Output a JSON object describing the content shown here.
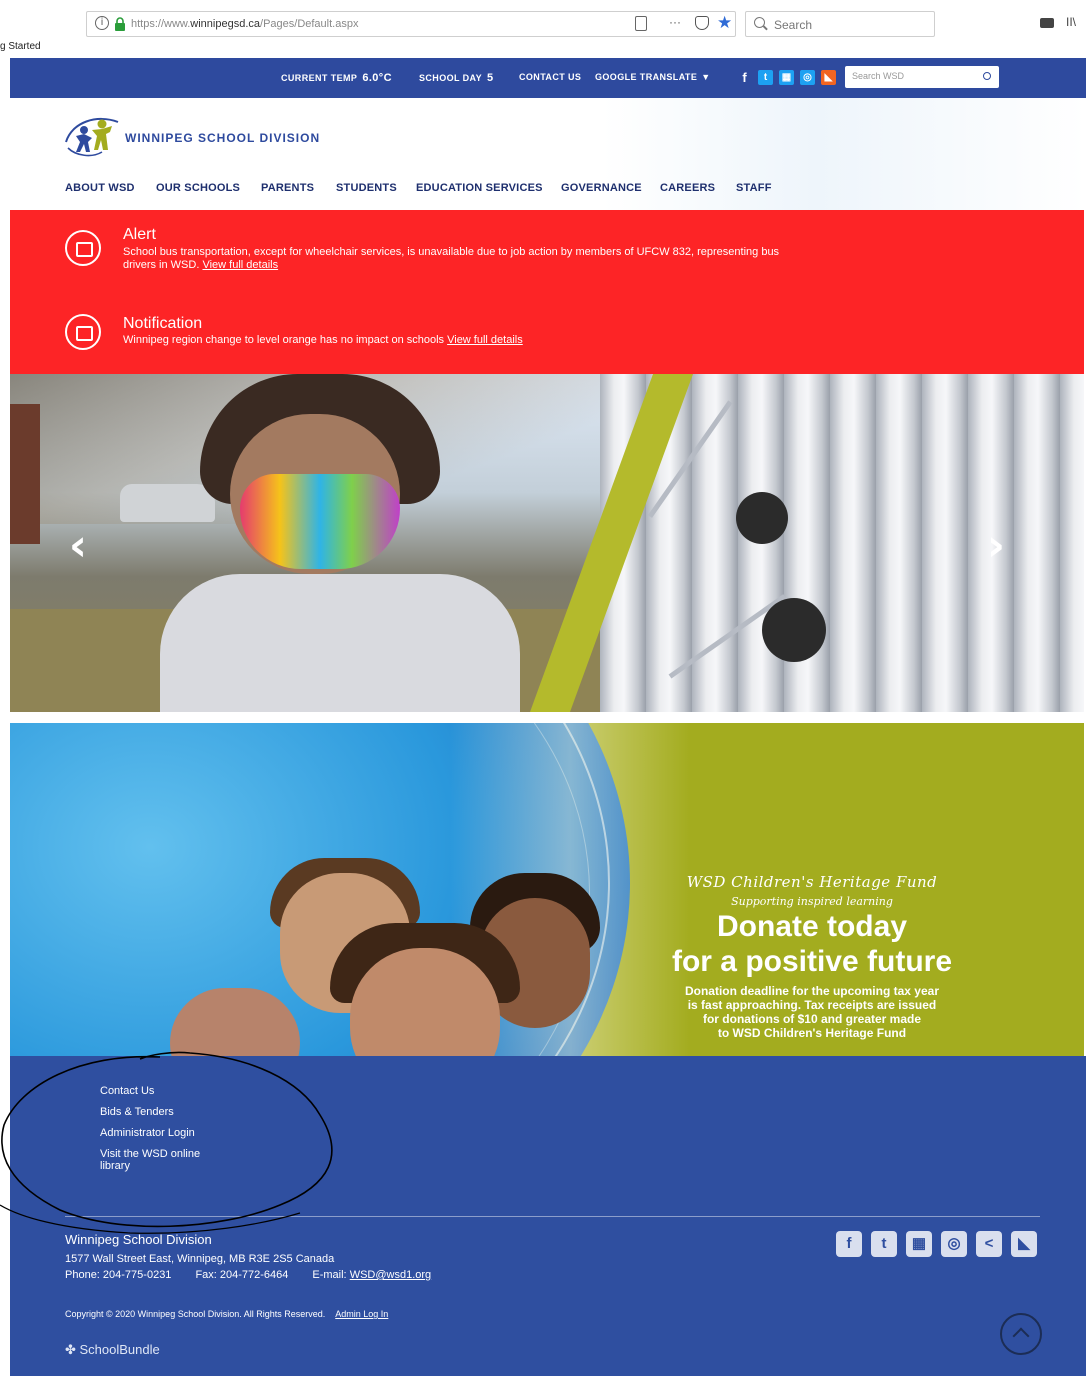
{
  "browser": {
    "url_prefix": "https://www.",
    "url_domain": "winnipegsd.ca",
    "url_path": "/Pages/Default.aspx",
    "more_label": "···",
    "search_placeholder": "Search",
    "library_label": "II\\",
    "bookmark_label": "g Started"
  },
  "topbar": {
    "temp_label": "CURRENT TEMP",
    "temp_value": "6.0°C",
    "schoolday_label": "SCHOOL DAY",
    "schoolday_value": "5",
    "contact_label": "CONTACT US",
    "translate_label": "GOOGLE TRANSLATE",
    "search_placeholder": "Search WSD",
    "social": [
      {
        "icon": "facebook-icon",
        "glyph": "f",
        "color": "#2e4a9e"
      },
      {
        "icon": "twitter-icon",
        "glyph": "t",
        "color": "#1da1f2"
      },
      {
        "icon": "calendar-icon",
        "glyph": "▦",
        "color": "#1da1f2"
      },
      {
        "icon": "instagram-icon",
        "glyph": "◎",
        "color": "#1da1f2"
      },
      {
        "icon": "rss-icon",
        "glyph": "◣",
        "color": "#f26522"
      }
    ]
  },
  "header": {
    "logo_text": "WINNIPEG SCHOOL DIVISION",
    "nav": [
      "ABOUT WSD",
      "OUR SCHOOLS",
      "PARENTS",
      "STUDENTS",
      "EDUCATION SERVICES",
      "GOVERNANCE",
      "CAREERS",
      "STAFF"
    ]
  },
  "alerts": [
    {
      "title": "Alert",
      "body_line1": "School bus transportation, except for wheelchair services, is unavailable due to job action by members of UFCW 832, representing bus",
      "body_line2": "drivers in WSD.",
      "link": "View full details"
    },
    {
      "title": "Notification",
      "body_line1": "Winnipeg region change to level orange has no impact on schools",
      "link": "View full details"
    }
  ],
  "slider": {
    "prev_glyph": "‹",
    "next_glyph": "›"
  },
  "banner": {
    "fund": "WSD Children's Heritage Fund",
    "tagline": "Supporting inspired learning",
    "headline1": "Donate today",
    "headline2": "for a positive future",
    "body": [
      "Donation deadline for the upcoming tax year",
      "is fast approaching. Tax receipts are issued",
      "for donations of $10 and greater made",
      "to WSD Children's Heritage Fund"
    ]
  },
  "footer": {
    "links": [
      "Contact Us",
      "Bids & Tenders",
      "Administrator Login",
      "Visit the WSD online",
      "library"
    ],
    "org": "Winnipeg School Division",
    "address": "1577 Wall Street East, Winnipeg, MB R3E 2S5 Canada",
    "phone": "Phone: 204-775-0231",
    "fax": "Fax: 204-772-6464",
    "email_label": "E-mail:",
    "email": "WSD@wsd1.org",
    "copyright": "Copyright © 2020 Winnipeg School Division. All Rights Reserved.",
    "admin_login": "Admin Log In",
    "schoolbundle": "SchoolBundle",
    "social": [
      {
        "icon": "facebook-icon",
        "glyph": "f"
      },
      {
        "icon": "twitter-icon",
        "glyph": "t"
      },
      {
        "icon": "calendar-icon",
        "glyph": "▦"
      },
      {
        "icon": "instagram-icon",
        "glyph": "◎"
      },
      {
        "icon": "share-icon",
        "glyph": "<"
      },
      {
        "icon": "rss-icon",
        "glyph": "◣"
      }
    ]
  },
  "colors": {
    "brand_blue": "#2e4a9e",
    "alert_red": "#fd2426",
    "banner_green": "#a3ac1f"
  }
}
